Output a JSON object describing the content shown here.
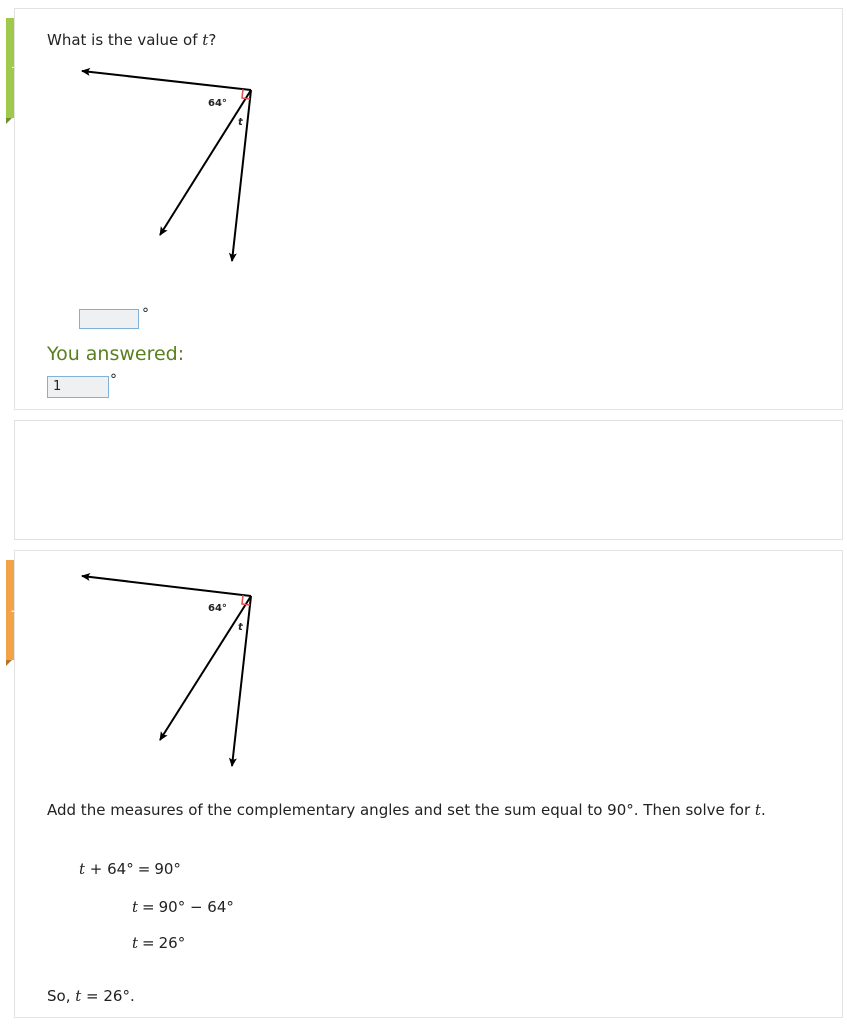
{
  "review_tab": {
    "label": "review"
  },
  "solve_tab": {
    "label": "solve"
  },
  "question": {
    "prefix": "What is the value of ",
    "variable": "t",
    "suffix": "?"
  },
  "diagram": {
    "angle_label": "64°",
    "variable_label": "t"
  },
  "answer_input": {
    "value": "",
    "unit": "°"
  },
  "you_answered": {
    "label": "You answered:",
    "value": "1",
    "unit": "°"
  },
  "solution": {
    "explanation_prefix": "Add the measures of the complementary angles and set the sum equal to 90°. Then solve for ",
    "explanation_var": "t",
    "explanation_suffix": ".",
    "step1": {
      "lhs_var": "t",
      "lhs_rest": " + 64°",
      "eq": "=",
      "rhs": "90°"
    },
    "step2": {
      "lhs_var": "t",
      "eq": "=",
      "rhs": "90° − 64°"
    },
    "step3": {
      "lhs_var": "t",
      "eq": "=",
      "rhs": "26°"
    },
    "conclusion_prefix": "So, ",
    "conclusion_var": "t",
    "conclusion_eq": " = ",
    "conclusion_value": "26°."
  },
  "colors": {
    "review_tab": "#9ec94a",
    "solve_tab": "#f3a347",
    "you_answered_text": "#5a7f1f",
    "right_angle_marker": "#e05050",
    "input_border": "#7fb2da"
  }
}
